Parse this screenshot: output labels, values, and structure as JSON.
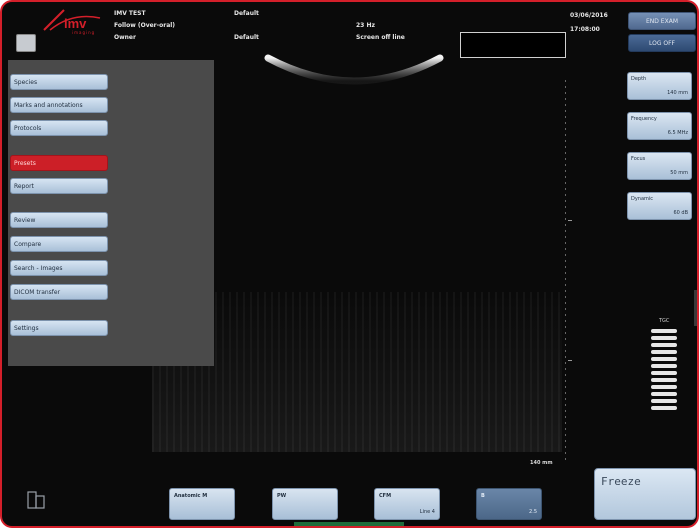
{
  "brand": {
    "logo_text": "imv",
    "sub_text": "imaging"
  },
  "header": {
    "patient_name": "IMV TEST",
    "exam": "Follow (Over-oral)",
    "operator": "Owner",
    "preset1": "Default",
    "preset2": "Default",
    "frame_rate": "23 Hz",
    "status": "Screen off line",
    "date": "03/06/2016",
    "time": "17:08:00"
  },
  "top_buttons": {
    "end_exam": "END EXAM",
    "log": "LOG OFF"
  },
  "menu": {
    "items": [
      {
        "label": "Species"
      },
      {
        "label": "Marks and annotations"
      },
      {
        "label": "Protocols"
      },
      {
        "label": "Presets",
        "active": true
      },
      {
        "label": "Report"
      },
      {
        "label": "Review"
      },
      {
        "label": "Compare"
      },
      {
        "label": "Search - Images"
      },
      {
        "label": "DICOM transfer"
      },
      {
        "label": "Settings"
      }
    ]
  },
  "params": [
    {
      "label": "Depth",
      "value": "140 mm"
    },
    {
      "label": "Frequency",
      "value": "6.5 MHz"
    },
    {
      "label": "Focus",
      "value": "50 mm"
    },
    {
      "label": "Dynamic",
      "value": "60 dB"
    }
  ],
  "tgc": {
    "label": "TGC"
  },
  "image": {
    "depth_readout": "140 mm"
  },
  "bottom": [
    {
      "label": "Anatomic M",
      "value": ""
    },
    {
      "label": "PW",
      "value": ""
    },
    {
      "label": "CFM",
      "value": "Line 4"
    },
    {
      "label": "B",
      "value": "2.5"
    }
  ],
  "freeze_label": "Freeze",
  "colors": {
    "accent": "#d41f2a",
    "button_blue": "#a9c0d8",
    "active": "#cc1f27"
  }
}
